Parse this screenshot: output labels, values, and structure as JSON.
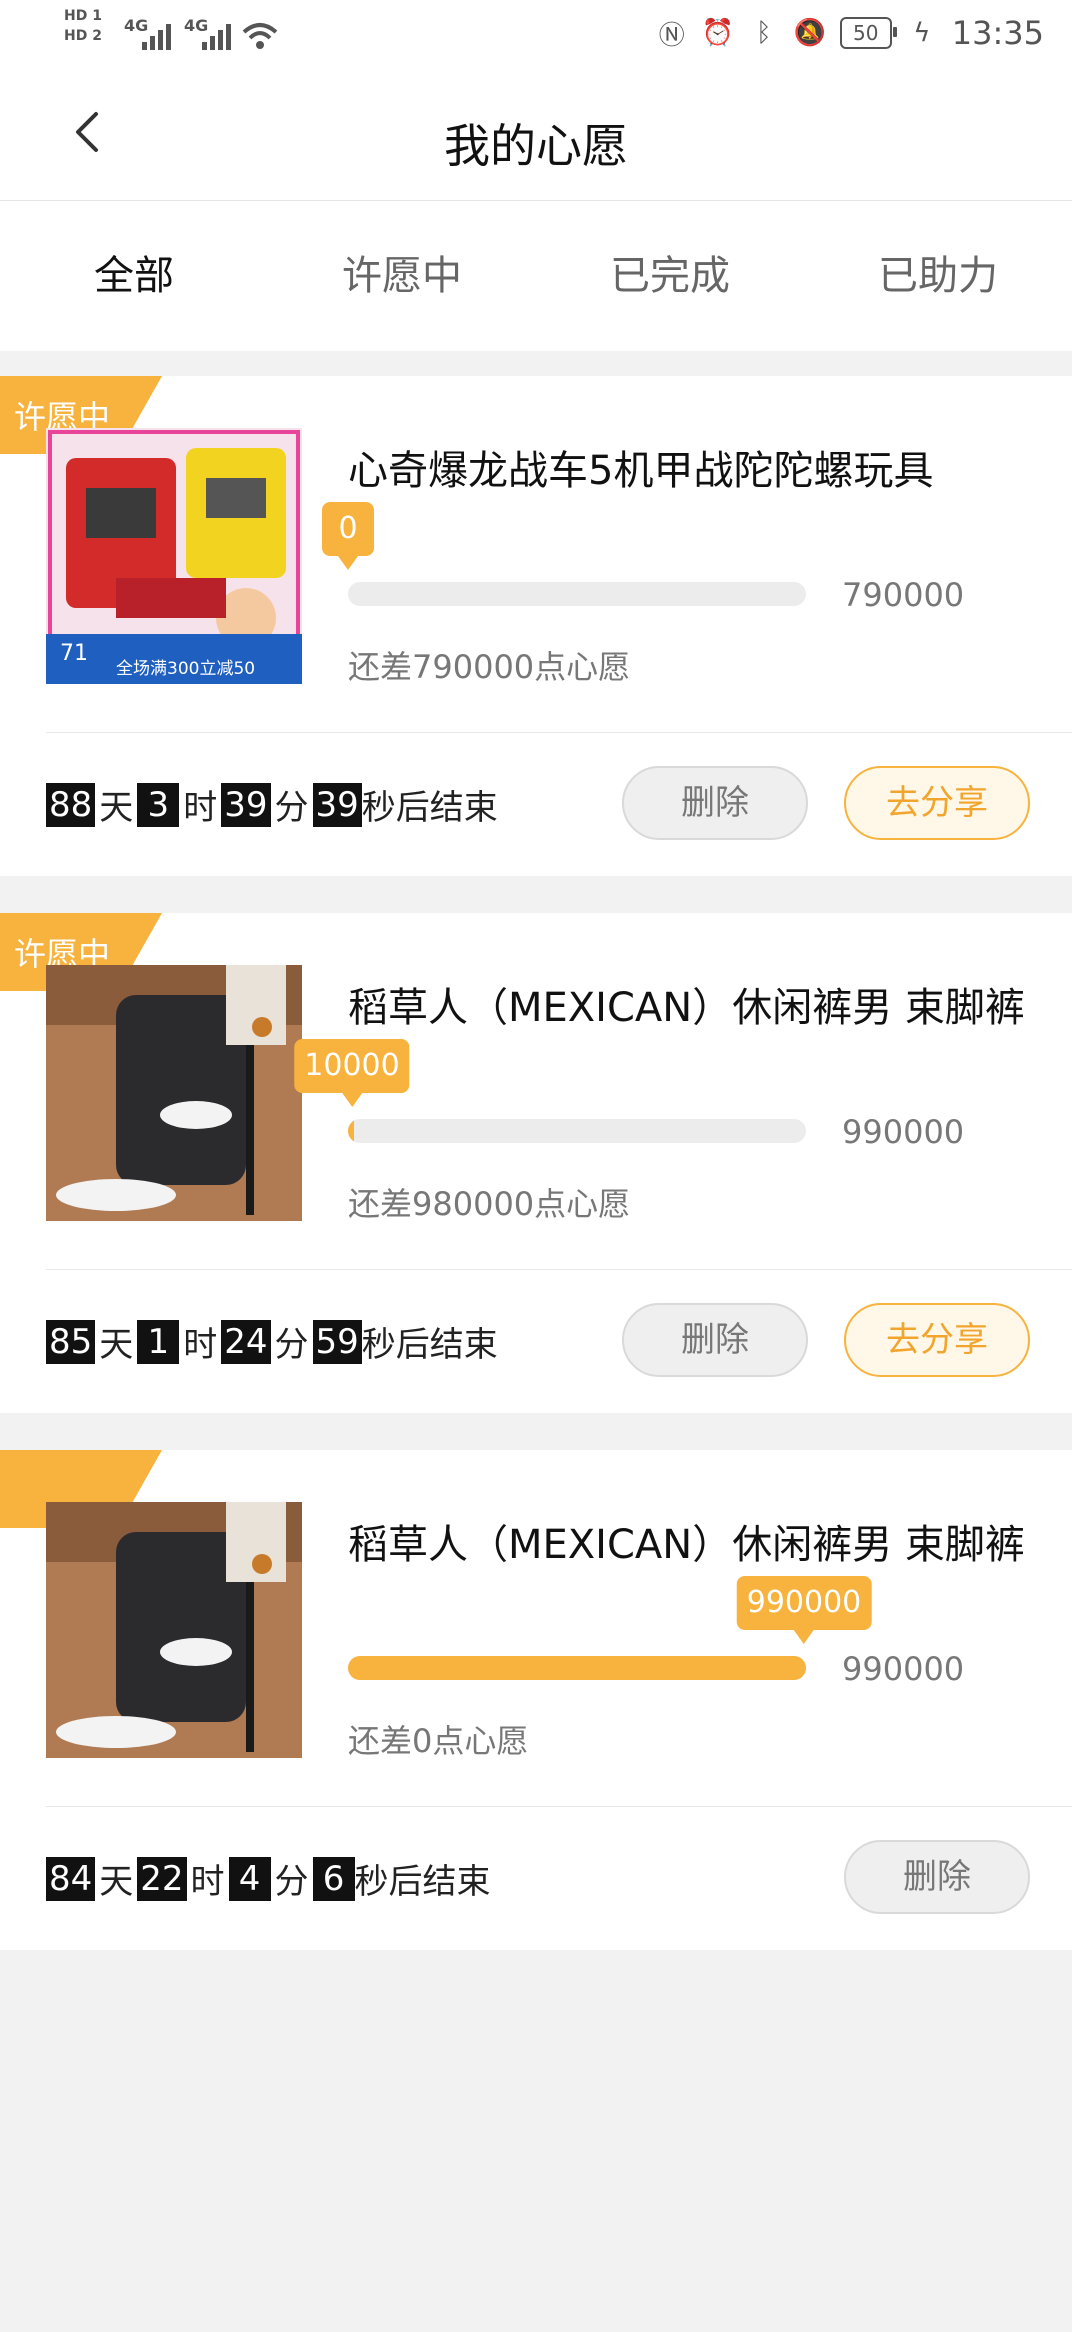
{
  "status_bar": {
    "hd1": "HD 1",
    "hd2": "HD 2",
    "net1": "4G",
    "net2": "4G",
    "battery": "50",
    "time": "13:35"
  },
  "header": {
    "title": "我的心愿"
  },
  "tabs": [
    {
      "label": "全部",
      "active": true
    },
    {
      "label": "许愿中",
      "active": false
    },
    {
      "label": "已完成",
      "active": false
    },
    {
      "label": "已助力",
      "active": false
    }
  ],
  "wishes": [
    {
      "status": "许愿中",
      "title": "心奇爆龙战车5机甲战陀陀螺玩具",
      "current": "0",
      "target": "790000",
      "progress": 0.0,
      "remaining": "还差790000点心愿",
      "countdown": {
        "days": "88",
        "hours": "3",
        "minutes": "39",
        "seconds": "39"
      },
      "thumb_badge_price": "71",
      "thumb_badge_promo": "全场满300立减50",
      "delete_label": "删除",
      "share_label": "去分享"
    },
    {
      "status": "许愿中",
      "title": "稻草人（MEXICAN）休闲裤男 束脚裤",
      "current": "10000",
      "target": "990000",
      "progress": 0.0101,
      "remaining": "还差980000点心愿",
      "countdown": {
        "days": "85",
        "hours": "1",
        "minutes": "24",
        "seconds": "59"
      },
      "delete_label": "删除",
      "share_label": "去分享"
    },
    {
      "status": "",
      "title": "稻草人（MEXICAN）休闲裤男 束脚裤",
      "current": "990000",
      "target": "990000",
      "progress": 1.0,
      "remaining": "还差0点心愿",
      "countdown": {
        "days": "84",
        "hours": "22",
        "minutes": "4",
        "seconds": "6"
      },
      "delete_label": "删除"
    }
  ],
  "countdown_units": {
    "day": "天",
    "hour": "时",
    "minute": "分",
    "second_suffix": "秒后结束"
  },
  "colors": {
    "accent": "#f7b33e",
    "background": "#f2f2f2"
  }
}
